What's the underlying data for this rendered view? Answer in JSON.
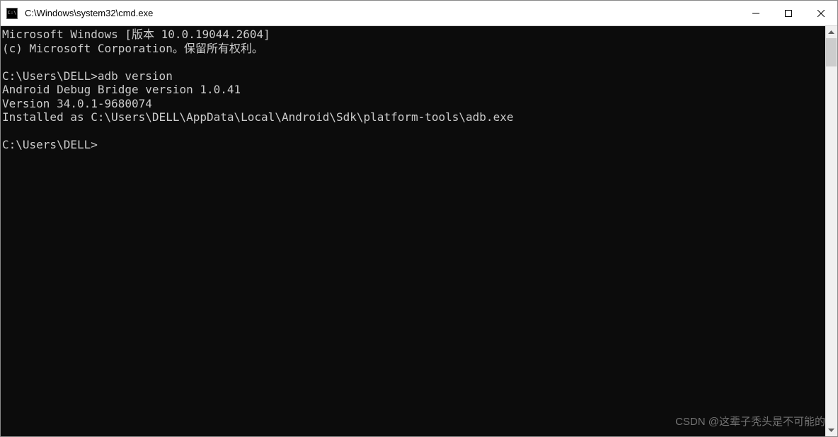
{
  "titlebar": {
    "icon_label": "C:\\",
    "title": "C:\\Windows\\system32\\cmd.exe"
  },
  "terminal": {
    "lines": [
      "Microsoft Windows [版本 10.0.19044.2604]",
      "(c) Microsoft Corporation。保留所有权利。",
      "",
      "C:\\Users\\DELL>adb version",
      "Android Debug Bridge version 1.0.41",
      "Version 34.0.1-9680074",
      "Installed as C:\\Users\\DELL\\AppData\\Local\\Android\\Sdk\\platform-tools\\adb.exe",
      "",
      "C:\\Users\\DELL>"
    ]
  },
  "watermark": "CSDN @这辈子秃头是不可能的"
}
